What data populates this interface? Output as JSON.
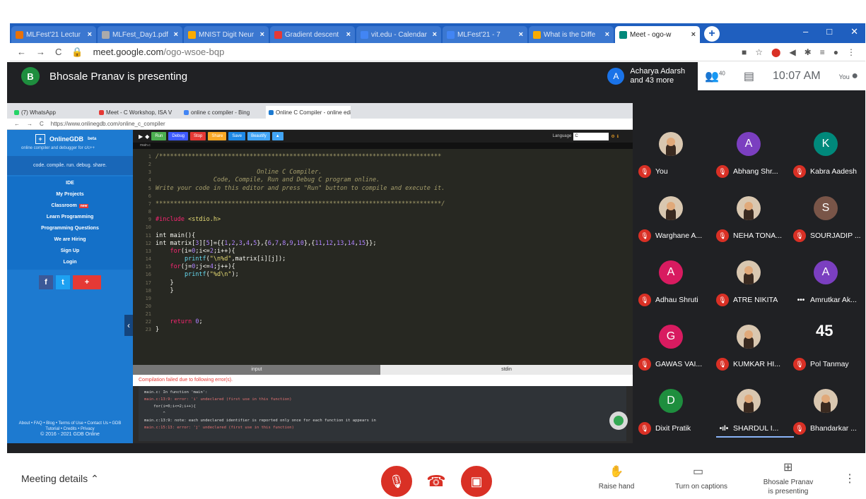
{
  "browser": {
    "tabs": [
      {
        "label": "MLFest'21 Lectur",
        "color": "#e8710a"
      },
      {
        "label": "MLFest_Day1.pdf",
        "color": "#aaaaaa"
      },
      {
        "label": "MNIST Digit Neur",
        "color": "#f9ab00"
      },
      {
        "label": "Gradient descent",
        "color": "#e53935"
      },
      {
        "label": "vit.edu - Calendar",
        "color": "#4285f4"
      },
      {
        "label": "MLFest'21 - 7",
        "color": "#4285f4"
      },
      {
        "label": "What is the Diffe",
        "color": "#f9ab00"
      },
      {
        "label": "Meet - ogo-w",
        "color": "#00897b"
      }
    ],
    "url_domain": "meet.google.com",
    "url_path": "/ogo-wsoe-bqp",
    "window_controls": [
      "–",
      "□",
      "✕"
    ]
  },
  "meet": {
    "presenter_initial": "B",
    "presenting_title": "Bhosale Pranav is presenting",
    "participants_initial": "A",
    "participants_line1": "Acharya Adarsh",
    "participants_line2": "and 43 more",
    "people_count": "40",
    "time": "10:07 AM",
    "you_label": "You"
  },
  "inner": {
    "tabs": [
      {
        "label": "(7) WhatsApp",
        "color": "#25d366"
      },
      {
        "label": "Meet - C Workshop, ISA V",
        "color": "#e53935"
      },
      {
        "label": "online c compiler - Bing",
        "color": "#4285f4"
      },
      {
        "label": "Online C Compiler - online edit",
        "color": "#1d7ad0"
      }
    ],
    "url": "https://www.onlinegdb.com/online_c_compiler"
  },
  "gdb": {
    "logo": "OnlineGDB",
    "beta": "beta",
    "subtitle": "online compiler and debugger for c/c++",
    "tagline": "code. compile. run. debug. share.",
    "nav": [
      "IDE",
      "My Projects",
      "Classroom",
      "Learn Programming",
      "Programming Questions",
      "We are Hiring",
      "Sign Up",
      "Login"
    ],
    "new_badge": "new",
    "footer1": "About • FAQ • Blog • Terms of Use • Contact Us • GDB",
    "footer2": "Tutorial • Credits • Privacy",
    "footer3": "© 2016 - 2021 GDB Online",
    "toolbar": [
      {
        "label": "Run",
        "color": "#4caf50"
      },
      {
        "label": "Debug",
        "color": "#3d5afe"
      },
      {
        "label": "Stop",
        "color": "#e53935"
      },
      {
        "label": "Share",
        "color": "#f9a825"
      },
      {
        "label": "Save",
        "color": "#1e88e5"
      },
      {
        "label": "Beautify",
        "color": "#42a5f5"
      }
    ],
    "language_label": "Language",
    "language_value": "C",
    "filename": "main.c",
    "input_tab": "input",
    "stdin_tab": "stdin",
    "error_heading": "Compilation failed due to following error(s).",
    "error_lines": [
      "main.c: In function 'main':",
      "main.c:13:9: error: 'i' undeclared (first use in this function)",
      "    for(i=0;i<=2;i++){",
      "        ^",
      "main.c:13:9: note: each undeclared identifier is reported only once for each function it appears in",
      "main.c:15:13: error: 'j' undeclared (first use in this function)"
    ]
  },
  "grid": [
    {
      "name": "You",
      "initial": "",
      "color": "",
      "photo": true,
      "state": "muted"
    },
    {
      "name": "Abhang Shr...",
      "initial": "A",
      "color": "#7b3fc0",
      "photo": false,
      "state": "muted"
    },
    {
      "name": "Kabra Aadesh",
      "initial": "K",
      "color": "#00897b",
      "photo": false,
      "state": "muted"
    },
    {
      "name": "Warghane A...",
      "initial": "",
      "color": "",
      "photo": true,
      "state": "muted"
    },
    {
      "name": "NEHA TONA...",
      "initial": "",
      "color": "",
      "photo": true,
      "state": "muted"
    },
    {
      "name": "SOURJADIP ...",
      "initial": "S",
      "color": "#795548",
      "photo": false,
      "state": "muted"
    },
    {
      "name": "Adhau Shruti",
      "initial": "A",
      "color": "#d81b60",
      "photo": false,
      "state": "muted"
    },
    {
      "name": "ATRE NIKITA",
      "initial": "",
      "color": "",
      "photo": true,
      "state": "muted"
    },
    {
      "name": "Amrutkar Ak...",
      "initial": "A",
      "color": "#7b3fc0",
      "photo": false,
      "state": "dots"
    },
    {
      "name": "GAWAS VAI...",
      "initial": "G",
      "color": "#d81b60",
      "photo": false,
      "state": "muted"
    },
    {
      "name": "KUMKAR HI...",
      "initial": "",
      "color": "",
      "photo": true,
      "state": "muted"
    },
    {
      "name": "Pol Tanmay",
      "initial": "",
      "color": "",
      "photo": false,
      "state": "muted",
      "count": "45"
    },
    {
      "name": "Dixit Pratik",
      "initial": "D",
      "color": "#1e8e3e",
      "photo": false,
      "state": "muted"
    },
    {
      "name": "SHARDUL I...",
      "initial": "",
      "color": "",
      "photo": true,
      "state": "talking"
    },
    {
      "name": "Bhandarkar ...",
      "initial": "",
      "color": "",
      "photo": true,
      "state": "muted"
    }
  ],
  "bottom": {
    "meeting_details": "Meeting details",
    "raise_hand": "Raise hand",
    "captions": "Turn on captions",
    "presenting1": "Bhosale Pranav",
    "presenting2": "is presenting"
  }
}
